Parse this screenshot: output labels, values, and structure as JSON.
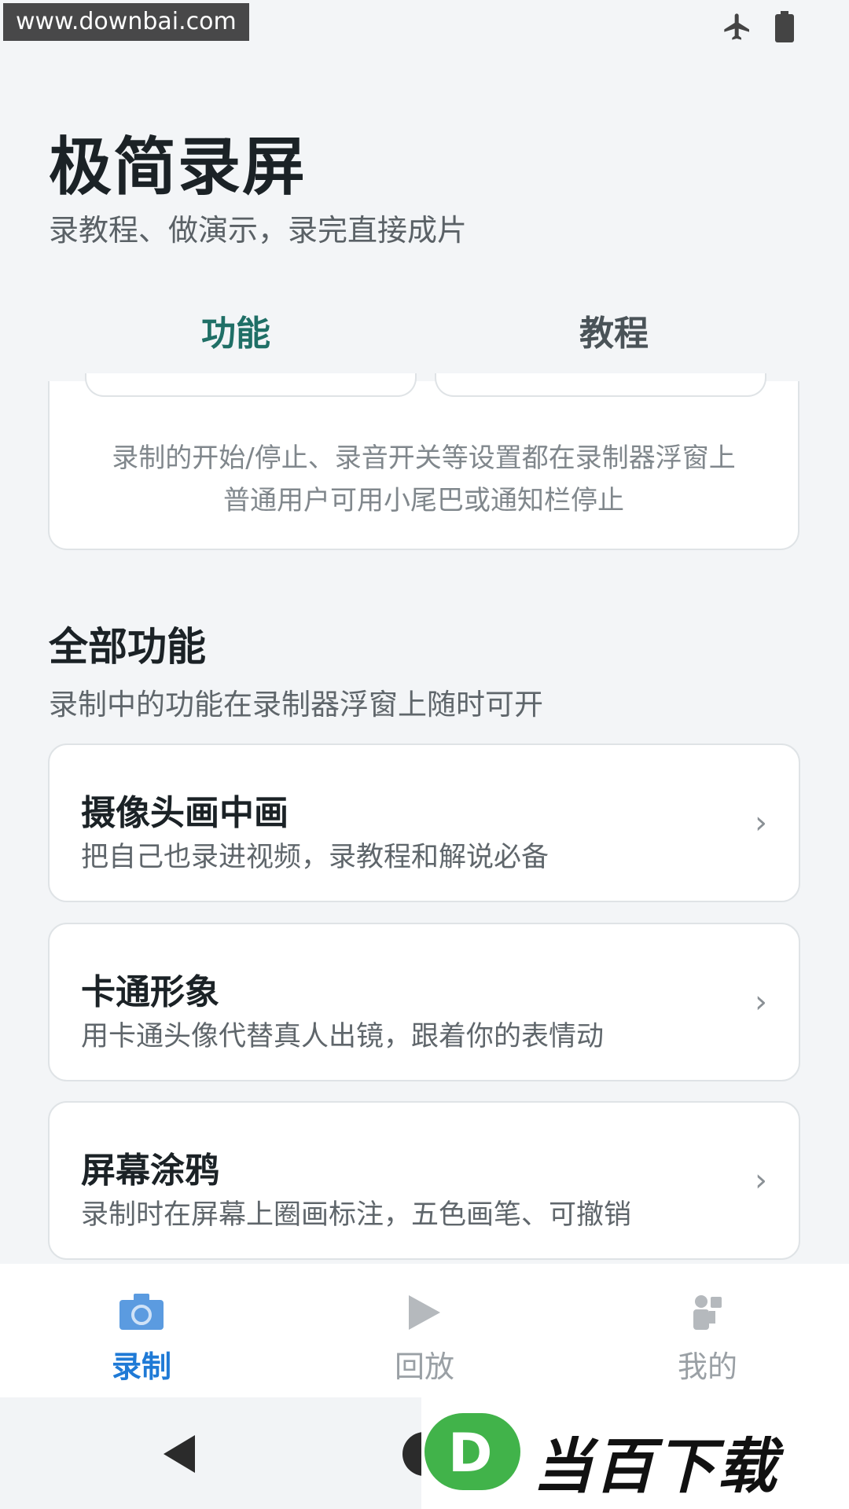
{
  "status_bar": {
    "watermark_text": "www.downbai.com",
    "icons": [
      "airplane-icon",
      "battery-icon"
    ]
  },
  "header": {
    "title": "极简录屏",
    "subtitle": "录教程、做演示，录完直接成片"
  },
  "tabs": [
    {
      "label": "功能",
      "active": true
    },
    {
      "label": "教程",
      "active": false
    }
  ],
  "info_card": {
    "line1": "录制的开始/停止、录音开关等设置都在录制器浮窗上",
    "line2": "普通用户可用小尾巴或通知栏停止"
  },
  "section": {
    "title": "全部功能",
    "subtitle": "录制中的功能在录制器浮窗上随时可开"
  },
  "features": [
    {
      "title": "摄像头画中画",
      "desc": "把自己也录进视频，录教程和解说必备"
    },
    {
      "title": "卡通形象",
      "desc": "用卡通头像代替真人出镜，跟着你的表情动"
    },
    {
      "title": "屏幕涂鸦",
      "desc": "录制时在屏幕上圈画标注，五色画笔、可撤销"
    }
  ],
  "chevron": "›",
  "bottom_nav": [
    {
      "label": "录制",
      "icon": "camera-icon",
      "active": true
    },
    {
      "label": "回放",
      "icon": "play-icon",
      "active": false
    },
    {
      "label": "我的",
      "icon": "person-icon",
      "active": false
    }
  ],
  "logo": {
    "letter": "D",
    "text": "当百下载"
  },
  "colors": {
    "accent": "#1f6f66",
    "nav_active": "#1f7ad6",
    "logo_green": "#41b34a"
  }
}
